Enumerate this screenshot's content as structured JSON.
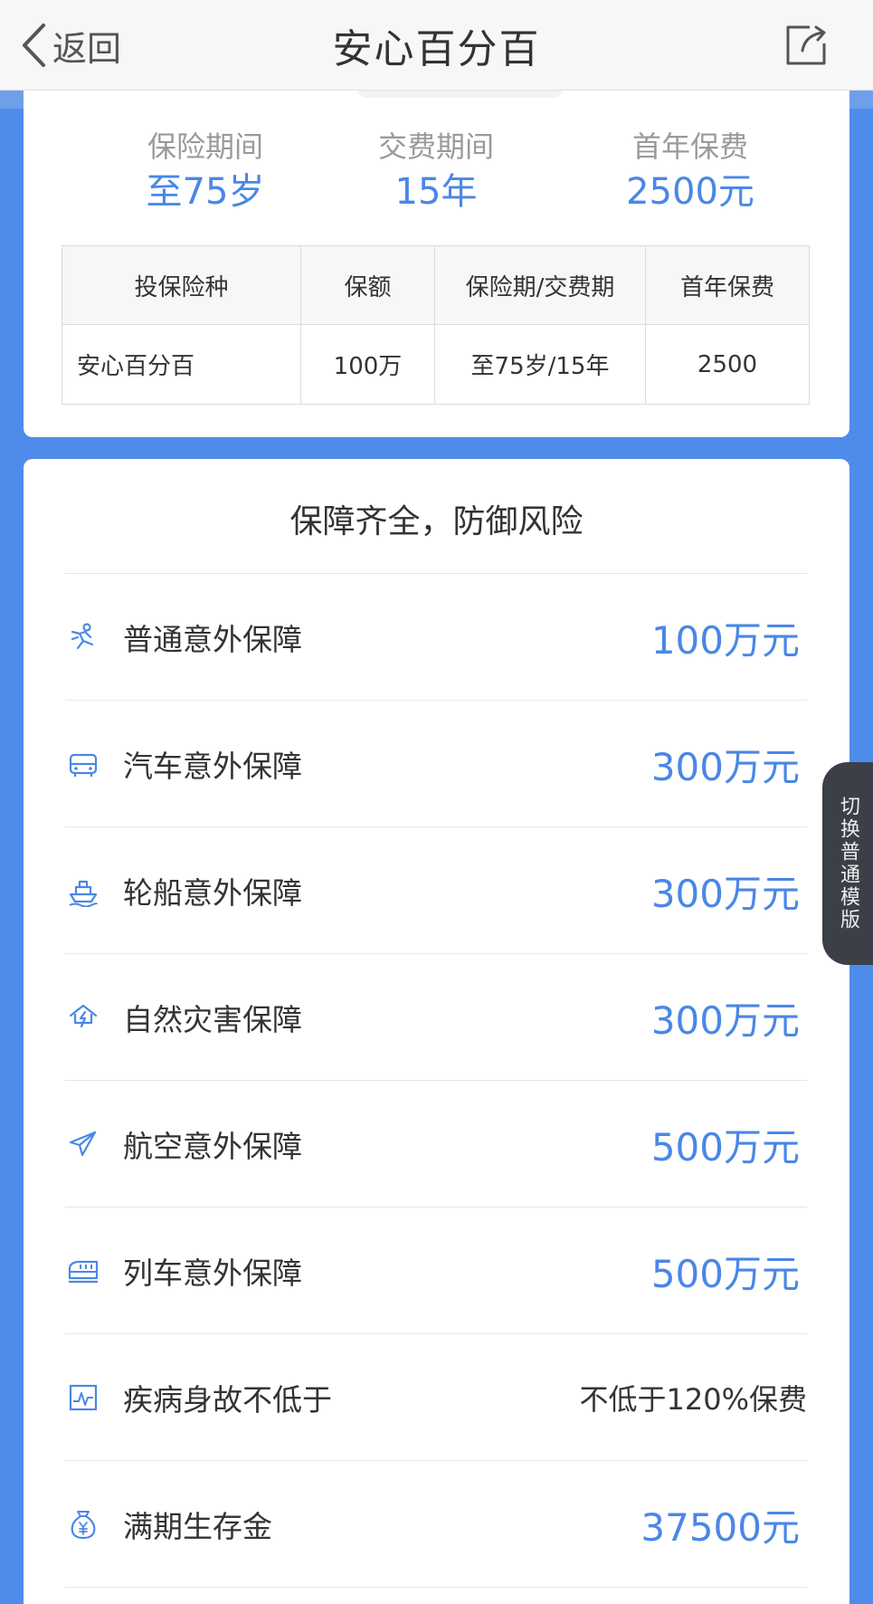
{
  "nav": {
    "back_label": "返回",
    "title": "安心百分百"
  },
  "summary": {
    "items": [
      {
        "label": "保险期间",
        "value": "至75岁"
      },
      {
        "label": "交费期间",
        "value": "15年"
      },
      {
        "label": "首年保费",
        "value": "2500元"
      }
    ]
  },
  "policy_table": {
    "headers": [
      "投保险种",
      "保额",
      "保险期/交费期",
      "首年保费"
    ],
    "rows": [
      [
        "安心百分百",
        "100万",
        "至75岁/15年",
        "2500"
      ]
    ]
  },
  "coverage": {
    "title": "保障齐全，防御风险",
    "items": [
      {
        "icon": "falling-person-icon",
        "label": "普通意外保障",
        "value": "100万元"
      },
      {
        "icon": "car-icon",
        "label": "汽车意外保障",
        "value": "300万元"
      },
      {
        "icon": "ship-icon",
        "label": "轮船意外保障",
        "value": "300万元"
      },
      {
        "icon": "natural-disaster-icon",
        "label": "自然灾害保障",
        "value": "300万元"
      },
      {
        "icon": "airplane-icon",
        "label": "航空意外保障",
        "value": "500万元"
      },
      {
        "icon": "train-icon",
        "label": "列车意外保障",
        "value": "500万元"
      },
      {
        "icon": "heartbeat-icon",
        "label": "疾病身故不低于",
        "value": "不低于120%保费"
      },
      {
        "icon": "money-bag-icon",
        "label": "满期生存金",
        "value": "37500元"
      }
    ]
  },
  "side_tab": {
    "label": "切换普通模版"
  },
  "colors": {
    "accent": "#4a87e6",
    "background": "#4e8beb",
    "side_tab": "#3b3f47"
  }
}
